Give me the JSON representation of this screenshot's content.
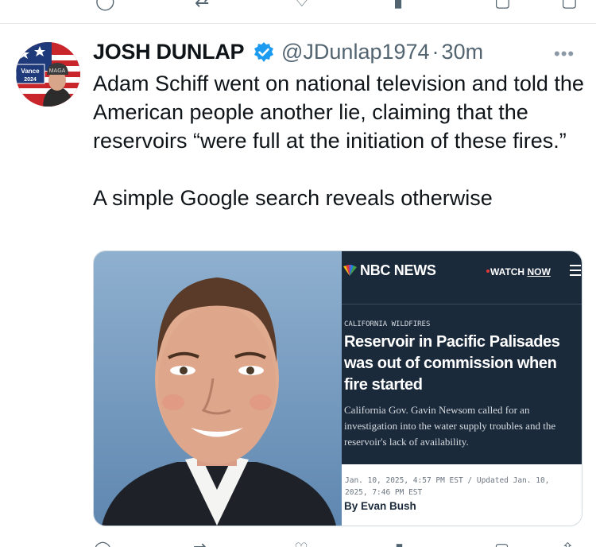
{
  "tweet": {
    "display_name": "JOSH DUNLAP",
    "handle": "@JDunlap1974",
    "separator": "·",
    "time": "30m",
    "paragraph_1": "Adam Schiff went on national television and told the American people another lie, claiming that the reservoirs “were full at the initiation of these fires.”",
    "paragraph_2": "A simple Google search reveals otherwise",
    "more_label": "•••"
  },
  "avatar": {
    "badge_name": "Vance",
    "badge_year": "2024",
    "hat_text": "MAGA"
  },
  "media": {
    "nbc": {
      "brand": "NBC NEWS",
      "watch_label": "WATCH",
      "watch_now": "NOW",
      "kicker": "CALIFORNIA WILDFIRES",
      "headline": "Reservoir in Pacific Palisades was out of commission when fire started",
      "dek": "California Gov. Gavin Newsom called for an investigation into the water supply troubles and the reservoir's lack of availability.",
      "timestamp": "Jan. 10, 2025, 4:57 PM EST / Updated Jan. 10, 2025, 7:46 PM EST",
      "byline": "By Evan Bush"
    }
  },
  "colors": {
    "verified": "#1d9bf0",
    "secondary_text": "#536471",
    "nbc_navy": "#1b2a3b"
  },
  "icons": [
    "reply-icon",
    "retweet-icon",
    "like-icon",
    "views-icon",
    "bookmark-icon",
    "share-icon",
    "verified-badge-icon",
    "more-icon",
    "peacock-icon",
    "menu-icon"
  ]
}
